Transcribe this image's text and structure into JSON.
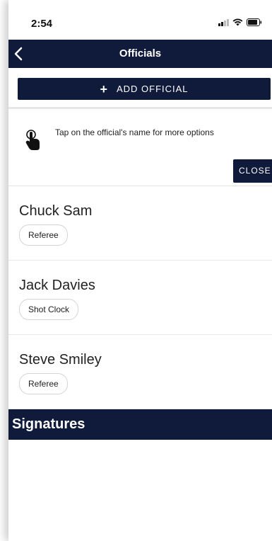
{
  "status": {
    "time": "2:54"
  },
  "nav": {
    "title": "Officials"
  },
  "actions": {
    "add_label": "ADD OFFICIAL",
    "close_label": "CLOSE"
  },
  "hint": {
    "text": "Tap on the official's name for more options"
  },
  "officials": [
    {
      "name": "Chuck Sam",
      "role": "Referee"
    },
    {
      "name": "Jack Davies",
      "role": "Shot Clock"
    },
    {
      "name": "Steve Smiley",
      "role": "Referee"
    }
  ],
  "signatures": {
    "title": "Signatures"
  },
  "colors": {
    "navy": "#101b3b",
    "white": "#ffffff",
    "divider": "#e8e8e8"
  }
}
